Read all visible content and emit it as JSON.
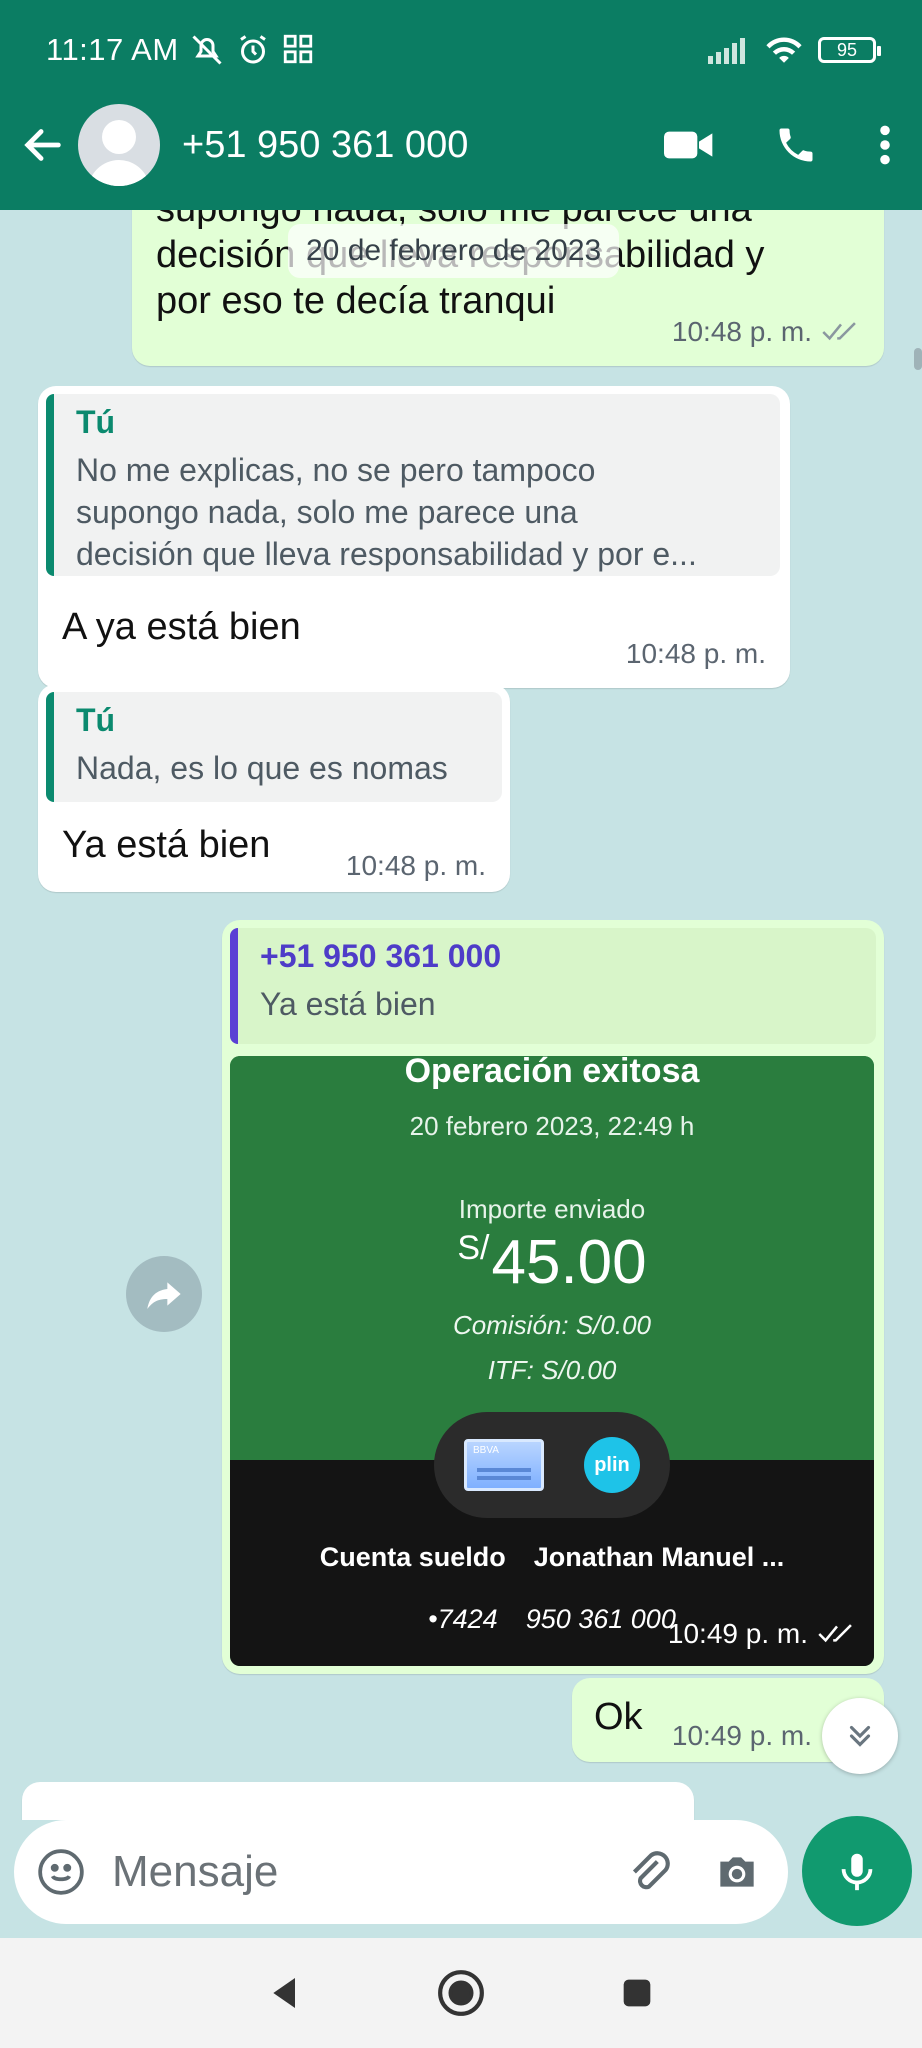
{
  "status_bar": {
    "time": "11:17 AM",
    "battery": "95",
    "icons_left": [
      "mute-bell-icon",
      "alarm-icon",
      "grid-app-icon"
    ],
    "icons_right": [
      "signal-icon",
      "wifi-icon",
      "battery-icon"
    ]
  },
  "header": {
    "title": "+51 950 361 000",
    "actions": [
      "video-call-icon",
      "phone-icon",
      "more-menu-icon"
    ]
  },
  "date_chip": "20 de febrero de 2023",
  "messages": [
    {
      "direction": "out",
      "text_lines": [
        "supongo nada, solo me parece una",
        "decisión que lleva responsabilidad y",
        "por eso te decía tranqui"
      ],
      "time": "10:48 p. m."
    },
    {
      "direction": "in",
      "quote_name": "Tú",
      "quote_lines": [
        "No me explicas, no se pero tampoco",
        "supongo nada, solo me parece una",
        "decisión que lleva responsabilidad y por e..."
      ],
      "text": "A ya está bien",
      "time": "10:48 p. m."
    },
    {
      "direction": "in",
      "quote_name": "Tú",
      "quote_lines": [
        "Nada, es lo que es nomas"
      ],
      "text": "Ya está bien",
      "time": "10:48 p. m."
    },
    {
      "direction": "out",
      "quote_name": "+51 950 361 000",
      "quote_lines": [
        "Ya está bien"
      ],
      "receipt": {
        "title": "Operación exitosa",
        "date": "20 febrero 2023, 22:49 h",
        "label": "Importe enviado",
        "currency": "S/",
        "amount": "45.00",
        "commission": "Comisión:  S/0.00",
        "itf": "ITF:  S/0.00",
        "from_name": "Cuenta sueldo",
        "from_number": "•7424",
        "to_name": "Jonathan Manuel ...",
        "to_number": "950 361 000",
        "card_label": "BBVA",
        "plin_label": "plin"
      },
      "time": "10:49 p. m."
    },
    {
      "direction": "out",
      "text": "Ok",
      "time": "10:49 p. m."
    }
  ],
  "input": {
    "placeholder": "Mensaje"
  },
  "colors": {
    "header": "#0b7d63",
    "accent": "#119a6f",
    "outgoing_bubble": "#e2ffd6",
    "incoming_bubble": "#ffffff",
    "quote_name_self": "#0b8a6f",
    "quote_name_contact": "#4e3cc8",
    "receipt_green": "#2a7d3e"
  }
}
